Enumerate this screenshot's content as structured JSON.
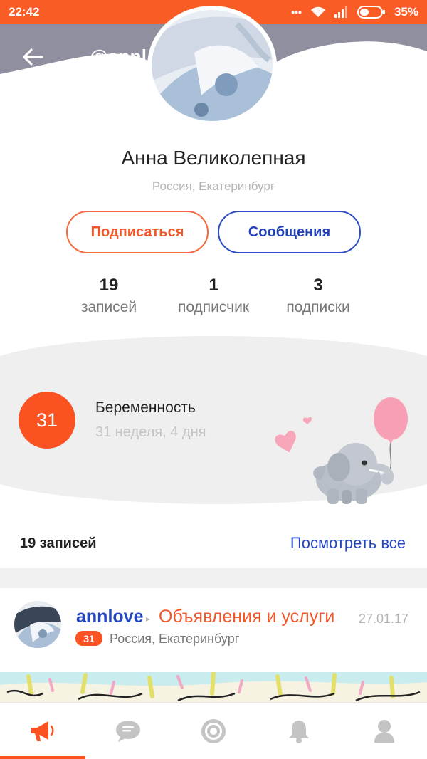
{
  "status_bar": {
    "time": "22:42",
    "dots": "•••",
    "battery": "35%",
    "icons": [
      "wifi-icon",
      "signal-icon",
      "battery-icon"
    ]
  },
  "header": {
    "username": "@annl…",
    "back_icon": "back-arrow-icon"
  },
  "profile": {
    "name": "Анна Великолепная",
    "location": "Россия, Екатеринбург"
  },
  "actions": {
    "subscribe_label": "Подписаться",
    "messages_label": "Сообщения"
  },
  "stats": [
    {
      "value": "19",
      "label": "записей"
    },
    {
      "value": "1",
      "label": "подписчик"
    },
    {
      "value": "3",
      "label": "подписки"
    }
  ],
  "pregnancy": {
    "week": "31",
    "title": "Беременность",
    "subtitle": "31 неделя, 4 дня"
  },
  "records": {
    "count_label": "19 записей",
    "view_all_label": "Посмотреть все"
  },
  "post": {
    "author": "annlove",
    "arrow": "▸",
    "category": "Объявления и услуги",
    "date": "27.01.17",
    "badge": "31",
    "location": "Россия, Екатеринбург"
  },
  "bottom_nav": [
    {
      "icon": "megaphone-icon",
      "active": true
    },
    {
      "icon": "chat-icon",
      "active": false
    },
    {
      "icon": "target-icon",
      "active": false
    },
    {
      "icon": "bell-icon",
      "active": false
    },
    {
      "icon": "user-icon",
      "active": false
    }
  ],
  "colors": {
    "accent_orange": "#fa5221",
    "header_gray": "#8f8fa0",
    "link_blue": "#2346c0"
  }
}
